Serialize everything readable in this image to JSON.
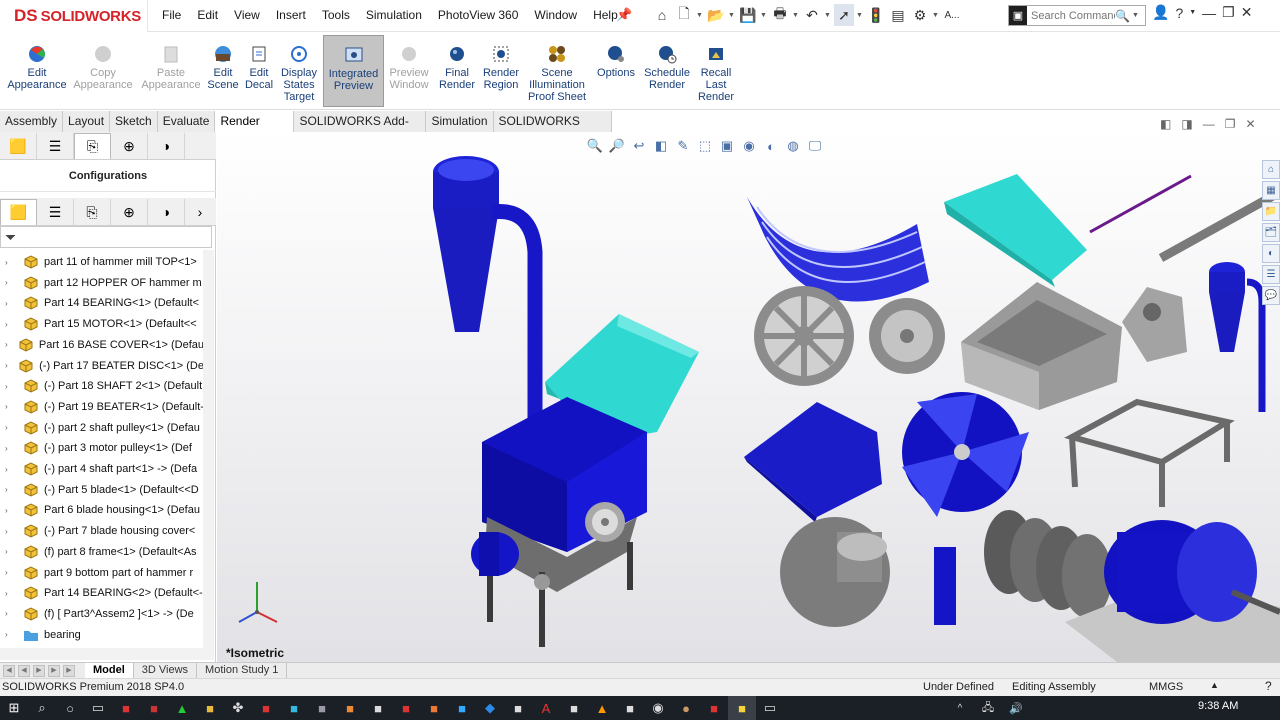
{
  "app": {
    "brand_prefix": "DS",
    "brand": "SOLIDWORKS"
  },
  "menu": [
    "File",
    "Edit",
    "View",
    "Insert",
    "Tools",
    "Simulation",
    "PhotoView 360",
    "Window",
    "Help"
  ],
  "search": {
    "placeholder": "Search Commands"
  },
  "quickaccess_label": "A...",
  "ribbon": [
    {
      "label": "Edit\nAppearance",
      "disabled": false
    },
    {
      "label": "Copy\nAppearance",
      "disabled": true
    },
    {
      "label": "Paste\nAppearance",
      "disabled": true
    },
    {
      "label": "Edit\nScene",
      "disabled": false
    },
    {
      "label": "Edit\nDecal",
      "disabled": false
    },
    {
      "label": "Display\nStates\nTarget",
      "disabled": false
    },
    {
      "label": "Integrated\nPreview",
      "disabled": false,
      "active": true
    },
    {
      "label": "Preview\nWindow",
      "disabled": true
    },
    {
      "label": "Final\nRender",
      "disabled": false
    },
    {
      "label": "Render\nRegion",
      "disabled": false
    },
    {
      "label": "Scene\nIllumination\nProof Sheet",
      "disabled": false
    },
    {
      "label": "Options",
      "disabled": false
    },
    {
      "label": "Schedule\nRender",
      "disabled": false
    },
    {
      "label": "Recall\nLast\nRender",
      "disabled": false
    }
  ],
  "tabs": [
    "Assembly",
    "Layout",
    "Sketch",
    "Evaluate",
    "Render Tools",
    "SOLIDWORKS Add-Ins",
    "Simulation",
    "SOLIDWORKS MBD"
  ],
  "selected_tab": "Render Tools",
  "panel": {
    "configurations_title": "Configurations"
  },
  "tree": [
    "part 11 of hammer mill TOP<1>",
    "part 12 HOPPER OF hammer m",
    "Part 14 BEARING<1> (Default<",
    "Part 15 MOTOR<1> (Default<<",
    "Part 16 BASE COVER<1> (Defau",
    "(-) Part 17 BEATER DISC<1> (De",
    "(-) Part 18 SHAFT 2<1> (Default",
    "(-) Part 19 BEATER<1> (Default-",
    "(-) part 2 shaft pulley<1> (Defau",
    "(-) part 3 motor pulley<1> (Def",
    "(-) part 4 shaft part<1> -> (Defa",
    "(-) Part 5 blade<1> (Default<<D",
    "Part 6 blade housing<1> (Defau",
    "(-) Part 7 blade housing cover<",
    "(f) part 8 frame<1> (Default<As",
    "part 9 bottom part of hammer r",
    "Part 14 BEARING<2> (Default<-",
    "(f) [ Part3^Assem2 ]<1> -> (De",
    "bearing"
  ],
  "view_label": "*Isometric",
  "bottom_tabs": [
    "Model",
    "3D Views",
    "Motion Study 1"
  ],
  "status": {
    "product": "SOLIDWORKS Premium 2018 SP4.0",
    "state": "Under Defined",
    "mode": "Editing Assembly",
    "units": "MMGS"
  },
  "clock": "9:38 AM",
  "colors": {
    "part_blue": "#1a1ad6",
    "hopper_cyan": "#2fd8d0",
    "brand_red": "#d5232a"
  }
}
